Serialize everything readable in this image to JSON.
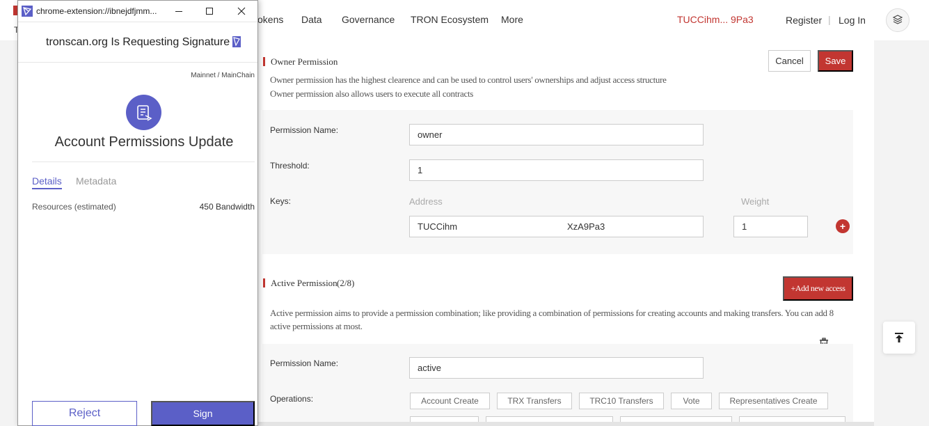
{
  "nav": {
    "items": [
      "okens",
      "Data",
      "Governance",
      "TRON Ecosystem",
      "More"
    ],
    "address": "TUCCihm...  9Pa3",
    "register": "Register",
    "separator": "|",
    "login": "Log In",
    "behind_text": "T"
  },
  "owner": {
    "title": "Owner Permission",
    "desc_line1": "Owner permission has the highest clearence and can be used to control users' ownerships and adjust access structure",
    "desc_line2": "Owner permission also allows users to execute all contracts",
    "cancel_label": "Cancel",
    "save_label": "Save",
    "permission_name_label": "Permission Name:",
    "permission_name_value": "owner",
    "threshold_label": "Threshold:",
    "threshold_value": "1",
    "keys_label": "Keys:",
    "address_col": "Address",
    "weight_col": "Weight",
    "key_address_start": "TUCCihm",
    "key_address_end": "XzA9Pa3",
    "key_weight": "1",
    "add_key": "+"
  },
  "active": {
    "title": "Active Permission",
    "count": "(2/8)",
    "add_label": "+Add new access",
    "desc_line1": "Active permission aims to provide a permission combination; like providing a combination of permissions for creating accounts and making transfers. You can add 8",
    "desc_line2": "active permissions at most.",
    "permission_name_label": "Permission Name:",
    "permission_name_value": "active",
    "operations_label": "Operations:",
    "operations": [
      "Account Create",
      "TRX Transfers",
      "TRC10 Transfers",
      "Vote",
      "Representatives Create"
    ]
  },
  "popup": {
    "url": "chrome-extension://ibnejdfjmm...",
    "header_title": "tronscan.org Is Requesting Signature",
    "network": "Mainnet / MainChain",
    "heading": "Account Permissions Update",
    "tab_details": "Details",
    "tab_metadata": "Metadata",
    "resources_label": "Resources (estimated)",
    "resources_value": "450 Bandwidth",
    "reject_label": "Reject",
    "sign_label": "Sign",
    "accent_color": "#5b5fc7"
  },
  "colors": {
    "brand_red": "#c23631",
    "popup_accent": "#5b5fc7"
  }
}
